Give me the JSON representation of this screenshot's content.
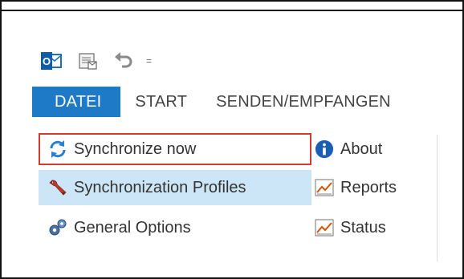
{
  "quick_access": {
    "icons": [
      "outlook-app-icon",
      "mailbox-icon",
      "undo-icon",
      "customize-dropdown-icon"
    ],
    "app_letter": "O",
    "dropdown_glyph": "="
  },
  "tabs": [
    {
      "label": "DATEI",
      "active": true
    },
    {
      "label": "START",
      "active": false
    },
    {
      "label": "SENDEN/EMPFANGEN",
      "active": false
    }
  ],
  "ribbon": {
    "sync_now": {
      "label": "Synchronize now",
      "icon": "sync-arrows-icon"
    },
    "sync_profiles": {
      "label": "Synchronization Profiles",
      "icon": "wrench-icon"
    },
    "general_options": {
      "label": "General Options",
      "icon": "gears-icon"
    },
    "about": {
      "label": "About",
      "icon": "info-icon"
    },
    "reports": {
      "label": "Reports",
      "icon": "chart-icon"
    },
    "status": {
      "label": "Status",
      "icon": "chart-icon"
    }
  },
  "colors": {
    "accent": "#1e7ac6",
    "selected_bg": "#cde6f7",
    "highlight_border": "#d23c2c"
  }
}
